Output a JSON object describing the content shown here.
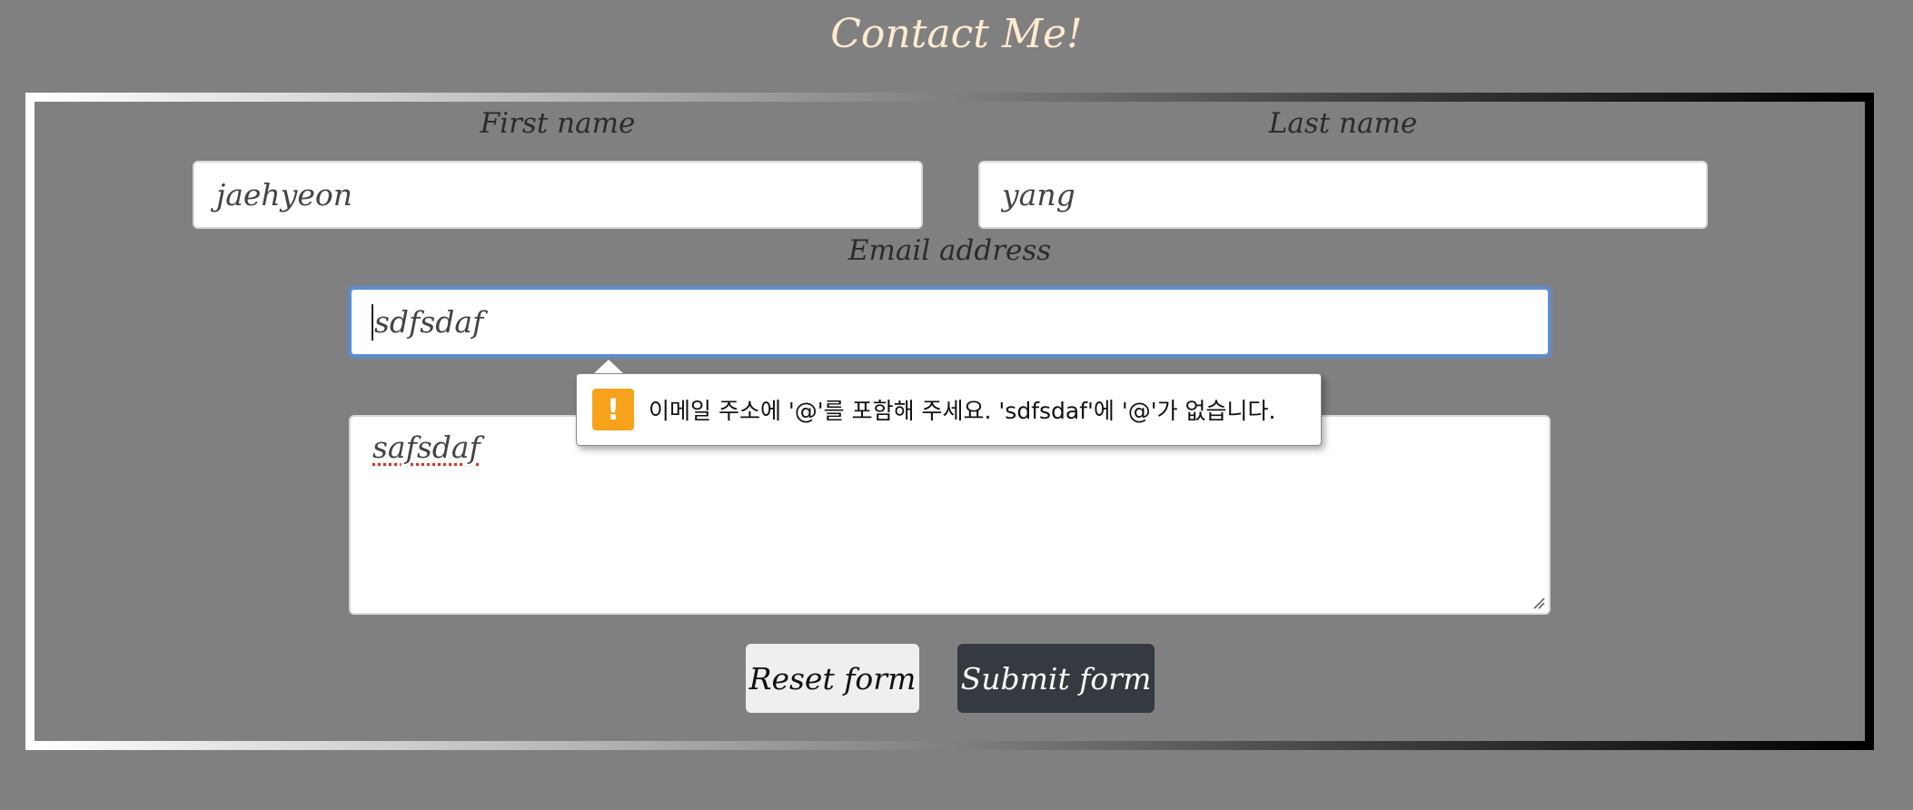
{
  "page": {
    "title": "Contact Me!"
  },
  "form": {
    "first_name": {
      "label": "First name",
      "value": "jaehyeon"
    },
    "last_name": {
      "label": "Last name",
      "value": "yang"
    },
    "email": {
      "label": "Email address",
      "value": "sdfsdaf"
    },
    "message": {
      "value": "safsdaf"
    },
    "reset_label": "Reset form",
    "submit_label": "Submit form"
  },
  "validation": {
    "icon": "warning-icon",
    "message": "이메일 주소에 '@'를 포함해 주세요. 'sdfsdaf'에 '@'가 없습니다."
  },
  "colors": {
    "background": "#808080",
    "title": "#fdebd0",
    "submit_button": "#343a40",
    "focus_ring": "#5b8fd6",
    "warning": "#f7a21b"
  }
}
